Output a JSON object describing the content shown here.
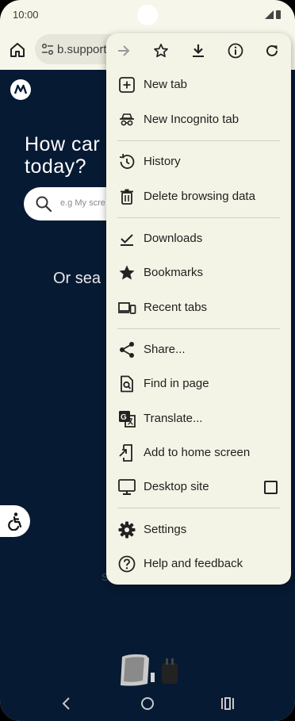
{
  "status_bar": {
    "time": "10:00"
  },
  "toolbar": {
    "url": "b.support"
  },
  "page": {
    "hero_title_line1": "How car",
    "hero_title_line2": "today?",
    "search_placeholder": "e.g My scre",
    "or_search": "Or sea",
    "faint_text": "S"
  },
  "menu": {
    "top_actions": [
      "forward-icon",
      "star-icon",
      "download-icon",
      "info-icon",
      "refresh-icon"
    ],
    "items": [
      {
        "label": "New tab",
        "icon": "new-tab-icon"
      },
      {
        "label": "New Incognito tab",
        "icon": "incognito-icon"
      },
      {
        "label": "History",
        "icon": "history-icon"
      },
      {
        "label": "Delete browsing data",
        "icon": "trash-icon"
      },
      {
        "label": "Downloads",
        "icon": "downloads-icon"
      },
      {
        "label": "Bookmarks",
        "icon": "bookmark-star-icon"
      },
      {
        "label": "Recent tabs",
        "icon": "devices-icon"
      },
      {
        "label": "Share...",
        "icon": "share-icon"
      },
      {
        "label": "Find in page",
        "icon": "find-in-page-icon"
      },
      {
        "label": "Translate...",
        "icon": "translate-icon"
      },
      {
        "label": "Add to home screen",
        "icon": "add-to-home-icon"
      },
      {
        "label": "Desktop site",
        "icon": "desktop-icon",
        "checked": false
      },
      {
        "label": "Settings",
        "icon": "settings-gear-icon"
      },
      {
        "label": "Help and feedback",
        "icon": "help-icon"
      }
    ]
  },
  "colors": {
    "page_bg": "#071a33",
    "menu_bg": "#f4f4e6",
    "chrome_bg": "#f6f6ea"
  }
}
